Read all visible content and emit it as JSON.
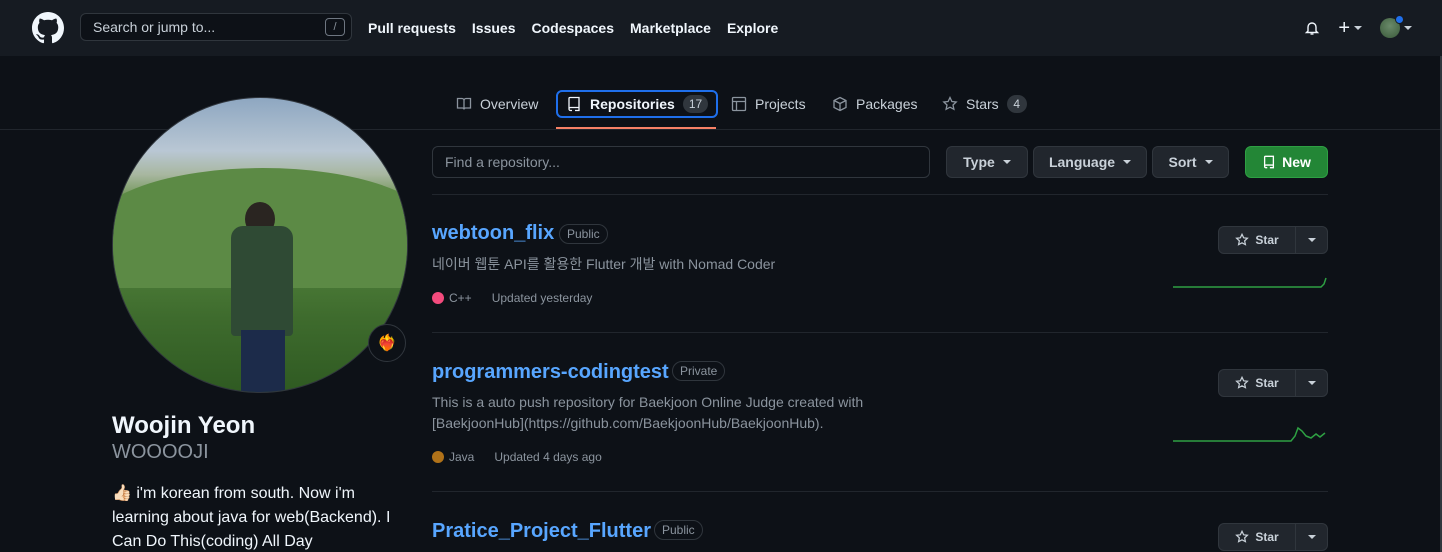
{
  "header": {
    "search_placeholder": "Search or jump to...",
    "search_shortcut": "/",
    "nav": [
      "Pull requests",
      "Issues",
      "Codespaces",
      "Marketplace",
      "Explore"
    ],
    "plus_label": "+"
  },
  "tabs": [
    {
      "label": "Overview",
      "icon": "book-icon"
    },
    {
      "label": "Repositories",
      "icon": "repo-icon",
      "count": "17",
      "selected": true
    },
    {
      "label": "Projects",
      "icon": "table-icon"
    },
    {
      "label": "Packages",
      "icon": "package-icon"
    },
    {
      "label": "Stars",
      "icon": "star-icon",
      "count": "4"
    }
  ],
  "profile": {
    "name": "Woojin Yeon",
    "login": "WOOOOJI",
    "bio": "👍🏻 i'm korean from south. Now i'm learning about java for web(Backend). I Can Do This(coding) All Day",
    "status_emoji": "❤️‍🔥"
  },
  "filters": {
    "find_placeholder": "Find a repository...",
    "type_label": "Type",
    "language_label": "Language",
    "sort_label": "Sort",
    "new_label": "New"
  },
  "repos": [
    {
      "name": "webtoon_flix",
      "visibility": "Public",
      "description": "네이버 웹툰 API를 활용한 Flutter 개발 with Nomad Coder",
      "language": "C++",
      "language_color": "#f34b7d",
      "updated": "Updated yesterday",
      "star_label": "Star"
    },
    {
      "name": "programmers-codingtest",
      "visibility": "Private",
      "description": "This is a auto push repository for Baekjoon Online Judge created with [BaekjoonHub](https://github.com/BaekjoonHub/BaekjoonHub).",
      "language": "Java",
      "language_color": "#b07219",
      "updated": "Updated 4 days ago",
      "star_label": "Star"
    },
    {
      "name": "Pratice_Project_Flutter",
      "visibility": "Public",
      "star_label": "Star"
    }
  ],
  "colors": {
    "accent": "#1f6feb",
    "link": "#58a6ff",
    "new_button": "#238636",
    "tab_underline": "#f78166"
  }
}
